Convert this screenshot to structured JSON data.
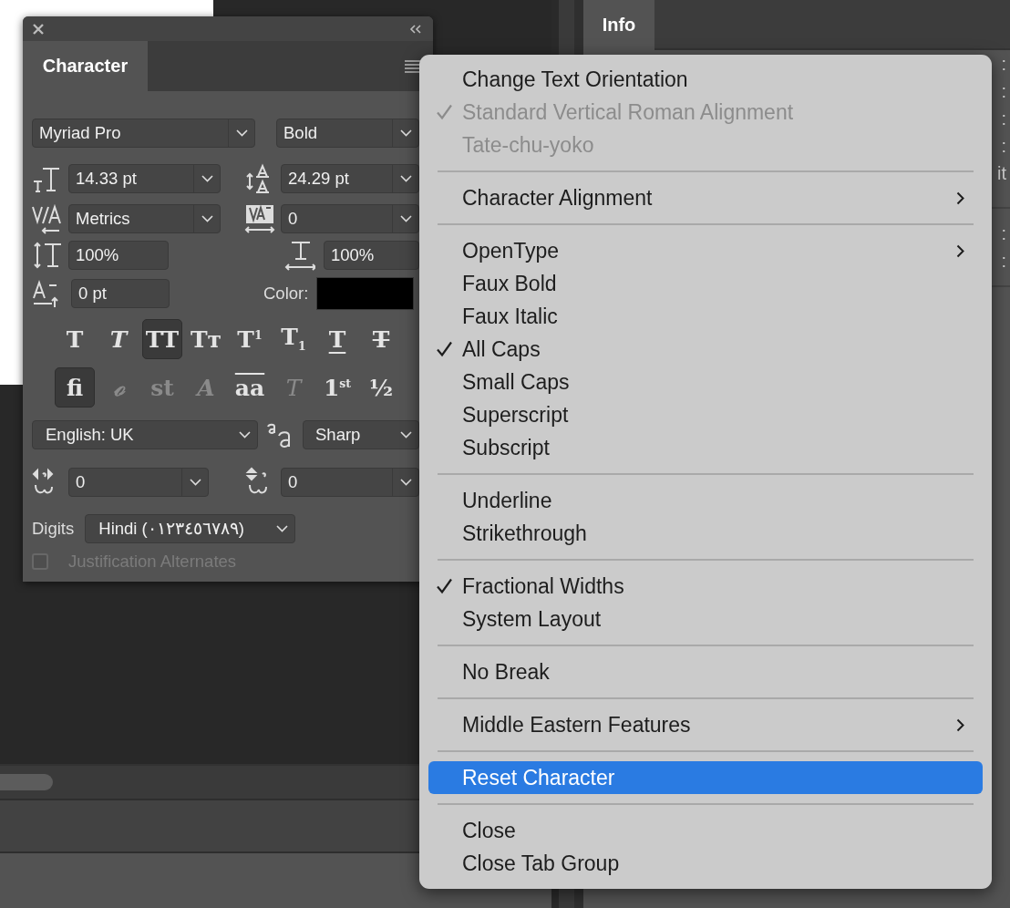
{
  "info_panel": {
    "tab": "Info",
    "readout_groups": [
      [
        ":",
        ":",
        ":",
        ":",
        "it"
      ],
      [
        ":",
        ":"
      ]
    ]
  },
  "character_panel": {
    "tab": "Character",
    "font_family": "Myriad Pro",
    "font_style": "Bold",
    "font_size": "14.33 pt",
    "leading": "24.29 pt",
    "kerning": "Metrics",
    "tracking": "0",
    "vertical_scale": "100%",
    "horizontal_scale": "100%",
    "baseline_shift": "0 pt",
    "color_label": "Color:",
    "color": "#000000",
    "style_buttons": [
      {
        "kind": "bold",
        "glyph": "T",
        "selected": false
      },
      {
        "kind": "italic",
        "glyph": "T",
        "selected": false
      },
      {
        "kind": "all_caps",
        "glyph": "TT",
        "selected": true
      },
      {
        "kind": "small_caps",
        "glyph": "Tᴛ",
        "selected": false
      },
      {
        "kind": "superscript",
        "glyph": "T$^{1}$",
        "selected": false
      },
      {
        "kind": "subscript",
        "glyph": "T$_{1}$",
        "selected": false
      },
      {
        "kind": "underline",
        "glyph": "T",
        "selected": false
      },
      {
        "kind": "strikethrough",
        "glyph": "T",
        "selected": false
      }
    ],
    "opentype_buttons": [
      {
        "kind": "ligatures",
        "glyph": "fi",
        "selected": true,
        "disabled": false
      },
      {
        "kind": "contextual",
        "glyph": "ℴ",
        "selected": false,
        "disabled": true
      },
      {
        "kind": "discretionary",
        "glyph": "st",
        "selected": false,
        "disabled": true
      },
      {
        "kind": "swash",
        "glyph": "A",
        "selected": false,
        "disabled": true
      },
      {
        "kind": "stylistic",
        "glyph": "aa",
        "selected": false,
        "disabled": false
      },
      {
        "kind": "titling",
        "glyph": "T",
        "selected": false,
        "disabled": true
      },
      {
        "kind": "ordinals",
        "glyph": "1$^{st}$",
        "selected": false,
        "disabled": false
      },
      {
        "kind": "fractions",
        "glyph": "½",
        "selected": false,
        "disabled": false
      }
    ],
    "language": "English: UK",
    "antialias": "Sharp",
    "kashida_horizontal": "0",
    "kashida_vertical": "0",
    "digits_label": "Digits",
    "digits": "Hindi (٠١٢٣٤٥٦٧٨٩)",
    "justification_alternates": {
      "label": "Justification Alternates",
      "checked": false,
      "disabled": true
    }
  },
  "menu": {
    "groups": [
      {
        "items": [
          {
            "label": "Change Text Orientation",
            "checked": false,
            "disabled": false,
            "submenu": false,
            "selected": false
          },
          {
            "label": "Standard Vertical Roman Alignment",
            "checked": true,
            "disabled": true,
            "submenu": false,
            "selected": false
          },
          {
            "label": "Tate-chu-yoko",
            "checked": false,
            "disabled": true,
            "submenu": false,
            "selected": false
          }
        ]
      },
      {
        "items": [
          {
            "label": "Character Alignment",
            "checked": false,
            "disabled": false,
            "submenu": true,
            "selected": false
          }
        ]
      },
      {
        "items": [
          {
            "label": "OpenType",
            "checked": false,
            "disabled": false,
            "submenu": true,
            "selected": false
          },
          {
            "label": "Faux Bold",
            "checked": false,
            "disabled": false,
            "submenu": false,
            "selected": false
          },
          {
            "label": "Faux Italic",
            "checked": false,
            "disabled": false,
            "submenu": false,
            "selected": false
          },
          {
            "label": "All Caps",
            "checked": true,
            "disabled": false,
            "submenu": false,
            "selected": false
          },
          {
            "label": "Small Caps",
            "checked": false,
            "disabled": false,
            "submenu": false,
            "selected": false
          },
          {
            "label": "Superscript",
            "checked": false,
            "disabled": false,
            "submenu": false,
            "selected": false
          },
          {
            "label": "Subscript",
            "checked": false,
            "disabled": false,
            "submenu": false,
            "selected": false
          }
        ]
      },
      {
        "items": [
          {
            "label": "Underline",
            "checked": false,
            "disabled": false,
            "submenu": false,
            "selected": false
          },
          {
            "label": "Strikethrough",
            "checked": false,
            "disabled": false,
            "submenu": false,
            "selected": false
          }
        ]
      },
      {
        "items": [
          {
            "label": "Fractional Widths",
            "checked": true,
            "disabled": false,
            "submenu": false,
            "selected": false
          },
          {
            "label": "System Layout",
            "checked": false,
            "disabled": false,
            "submenu": false,
            "selected": false
          }
        ]
      },
      {
        "items": [
          {
            "label": "No Break",
            "checked": false,
            "disabled": false,
            "submenu": false,
            "selected": false
          }
        ]
      },
      {
        "items": [
          {
            "label": "Middle Eastern Features",
            "checked": false,
            "disabled": false,
            "submenu": true,
            "selected": false
          }
        ]
      },
      {
        "items": [
          {
            "label": "Reset Character",
            "checked": false,
            "disabled": false,
            "submenu": false,
            "selected": true
          }
        ]
      },
      {
        "items": [
          {
            "label": "Close",
            "checked": false,
            "disabled": false,
            "submenu": false,
            "selected": false
          },
          {
            "label": "Close Tab Group",
            "checked": false,
            "disabled": false,
            "submenu": false,
            "selected": false
          }
        ]
      }
    ]
  }
}
